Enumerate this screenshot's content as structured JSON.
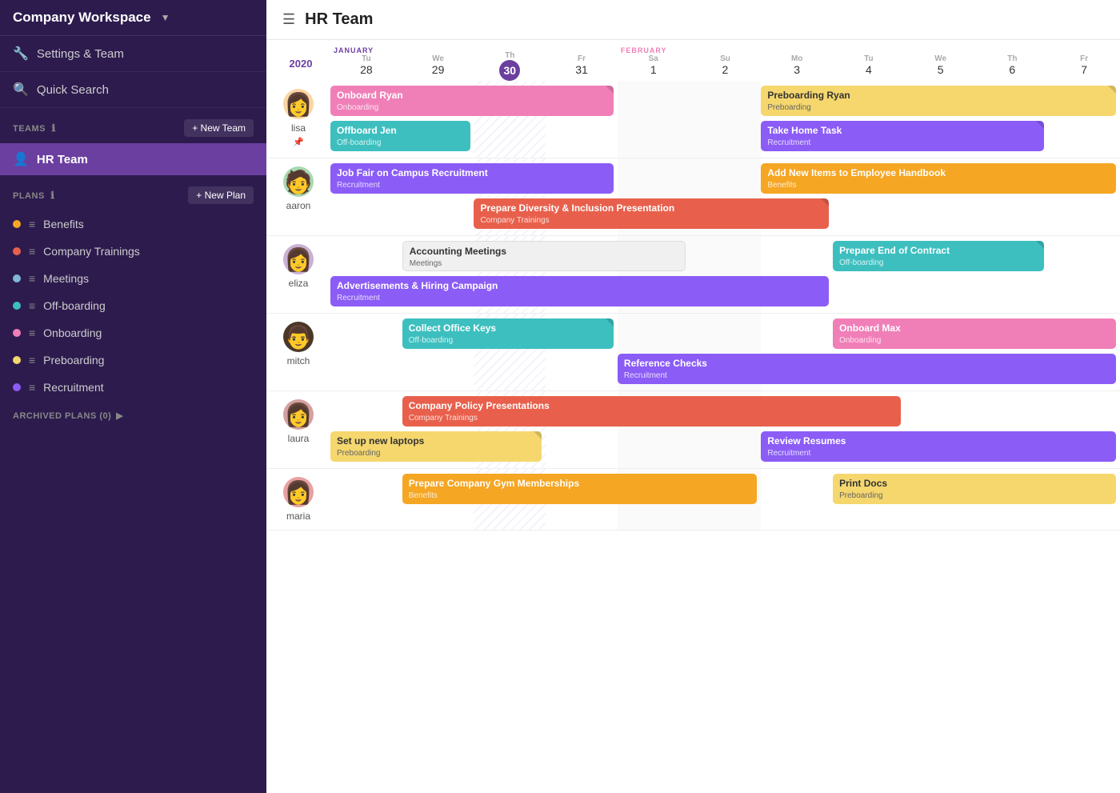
{
  "sidebar": {
    "workspace": "Company Workspace",
    "settings_label": "Settings & Team",
    "search_label": "Quick Search",
    "teams_label": "TEAMS",
    "new_team_label": "+ New Team",
    "active_team": "HR Team",
    "plans_label": "PLANS",
    "new_plan_label": "+ New Plan",
    "plans": [
      {
        "name": "Benefits",
        "color": "#f5a623",
        "id": "benefits"
      },
      {
        "name": "Company Trainings",
        "color": "#e8604c",
        "id": "trainings"
      },
      {
        "name": "Meetings",
        "color": "#7eb8d4",
        "id": "meetings"
      },
      {
        "name": "Off-boarding",
        "color": "#3dbfbf",
        "id": "offboarding"
      },
      {
        "name": "Onboarding",
        "color": "#f07fb8",
        "id": "onboarding"
      },
      {
        "name": "Preboarding",
        "color": "#f5d76e",
        "id": "preboarding"
      },
      {
        "name": "Recruitment",
        "color": "#8b5cf6",
        "id": "recruitment"
      }
    ],
    "archived_label": "ARCHIVED PLANS (0)"
  },
  "header": {
    "title": "HR Team"
  },
  "calendar": {
    "year": "2020",
    "columns": [
      {
        "abbr": "Tu",
        "num": "28",
        "month": "JANUARY",
        "id": "jan28"
      },
      {
        "abbr": "We",
        "num": "29",
        "month": "",
        "id": "jan29"
      },
      {
        "abbr": "Th",
        "num": "30",
        "month": "",
        "id": "jan30",
        "today": true
      },
      {
        "abbr": "Fr",
        "num": "31",
        "month": "",
        "id": "jan31"
      },
      {
        "abbr": "Sa",
        "num": "1",
        "month": "FEBRUARY",
        "id": "feb1",
        "weekend": true
      },
      {
        "abbr": "Su",
        "num": "2",
        "month": "",
        "id": "feb2",
        "weekend": true
      },
      {
        "abbr": "Mo",
        "num": "3",
        "month": "",
        "id": "feb3",
        "divider": true
      },
      {
        "abbr": "Tu",
        "num": "4",
        "month": "",
        "id": "feb4"
      },
      {
        "abbr": "We",
        "num": "5",
        "month": "",
        "id": "feb5"
      },
      {
        "abbr": "Th",
        "num": "6",
        "month": "",
        "id": "feb6"
      },
      {
        "abbr": "Fr",
        "num": "7",
        "month": "",
        "id": "feb7"
      }
    ],
    "users": [
      {
        "name": "lisa",
        "avatar_emoji": "👩",
        "avatar_color": "#f9d5a3",
        "has_star": true,
        "rows": [
          [
            {
              "col_start": 0,
              "col_span": 4,
              "title": "Onboard Ryan",
              "subtitle": "Onboarding",
              "color": "#f07fb8",
              "has_fold": true
            },
            {
              "col_start": 6,
              "col_span": 5,
              "title": "Preboarding Ryan",
              "subtitle": "Preboarding",
              "color": "#f5d76e",
              "has_fold": true,
              "dark_title": true,
              "dark_subtitle": true
            }
          ],
          [
            {
              "col_start": 0,
              "col_span": 2,
              "title": "Offboard Jen",
              "subtitle": "Off-boarding",
              "color": "#3dbfbf"
            },
            {
              "col_start": 6,
              "col_span": 4,
              "title": "Take Home Task",
              "subtitle": "Recruitment",
              "color": "#8b5cf6",
              "has_fold": true
            }
          ]
        ]
      },
      {
        "name": "aaron",
        "avatar_emoji": "🧑",
        "avatar_color": "#a8d8b0",
        "has_star": false,
        "rows": [
          [
            {
              "col_start": 0,
              "col_span": 4,
              "title": "Job Fair on Campus Recruitment",
              "subtitle": "Recruitment",
              "color": "#8b5cf6"
            },
            {
              "col_start": 6,
              "col_span": 5,
              "title": "Add New Items to Employee Handbook",
              "subtitle": "Benefits",
              "color": "#f5a623"
            }
          ],
          [
            {
              "col_start": 2,
              "col_span": 5,
              "title": "Prepare Diversity & Inclusion Presentation",
              "subtitle": "Company Trainings",
              "color": "#e8604c",
              "has_fold": true
            }
          ]
        ]
      },
      {
        "name": "eliza",
        "avatar_emoji": "👩",
        "avatar_color": "#c9b0d4",
        "has_star": false,
        "rows": [
          [
            {
              "col_start": 1,
              "col_span": 4,
              "title": "Accounting Meetings",
              "subtitle": "Meetings",
              "color": "#fff",
              "dark_title": true,
              "dark_subtitle": true
            },
            {
              "col_start": 7,
              "col_span": 3,
              "title": "Prepare End of Contract",
              "subtitle": "Off-boarding",
              "color": "#3dbfbf",
              "has_fold": true
            }
          ],
          [
            {
              "col_start": 0,
              "col_span": 7,
              "title": "Advertisements & Hiring Campaign",
              "subtitle": "Recruitment",
              "color": "#8b5cf6"
            }
          ]
        ]
      },
      {
        "name": "mitch",
        "avatar_emoji": "👨",
        "avatar_color": "#4a3728",
        "has_star": false,
        "rows": [
          [
            {
              "col_start": 1,
              "col_span": 3,
              "title": "Collect Office Keys",
              "subtitle": "Off-boarding",
              "color": "#3dbfbf",
              "has_fold": true
            },
            {
              "col_start": 7,
              "col_span": 4,
              "title": "Onboard Max",
              "subtitle": "Onboarding",
              "color": "#f07fb8"
            }
          ],
          [
            {
              "col_start": 4,
              "col_span": 7,
              "title": "Reference Checks",
              "subtitle": "Recruitment",
              "color": "#8b5cf6"
            }
          ]
        ]
      },
      {
        "name": "laura",
        "avatar_emoji": "👩",
        "avatar_color": "#d4a0a0",
        "has_star": false,
        "rows": [
          [
            {
              "col_start": 1,
              "col_span": 7,
              "title": "Company Policy Presentations",
              "subtitle": "Company Trainings",
              "color": "#e8604c"
            }
          ],
          [
            {
              "col_start": 0,
              "col_span": 3,
              "title": "Set up new laptops",
              "subtitle": "Preboarding",
              "color": "#f5d76e",
              "dark_title": true,
              "dark_subtitle": true,
              "has_fold": true
            },
            {
              "col_start": 6,
              "col_span": 5,
              "title": "Review Resumes",
              "subtitle": "Recruitment",
              "color": "#8b5cf6"
            }
          ]
        ]
      },
      {
        "name": "maria",
        "avatar_emoji": "👩",
        "avatar_color": "#e8a0a0",
        "has_star": false,
        "rows": [
          [
            {
              "col_start": 1,
              "col_span": 5,
              "title": "Prepare Company Gym Memberships",
              "subtitle": "Benefits",
              "color": "#f5a623"
            },
            {
              "col_start": 7,
              "col_span": 4,
              "title": "Print Docs",
              "subtitle": "Preboarding",
              "color": "#f5d76e",
              "dark_title": true,
              "dark_subtitle": true
            }
          ]
        ]
      }
    ]
  }
}
